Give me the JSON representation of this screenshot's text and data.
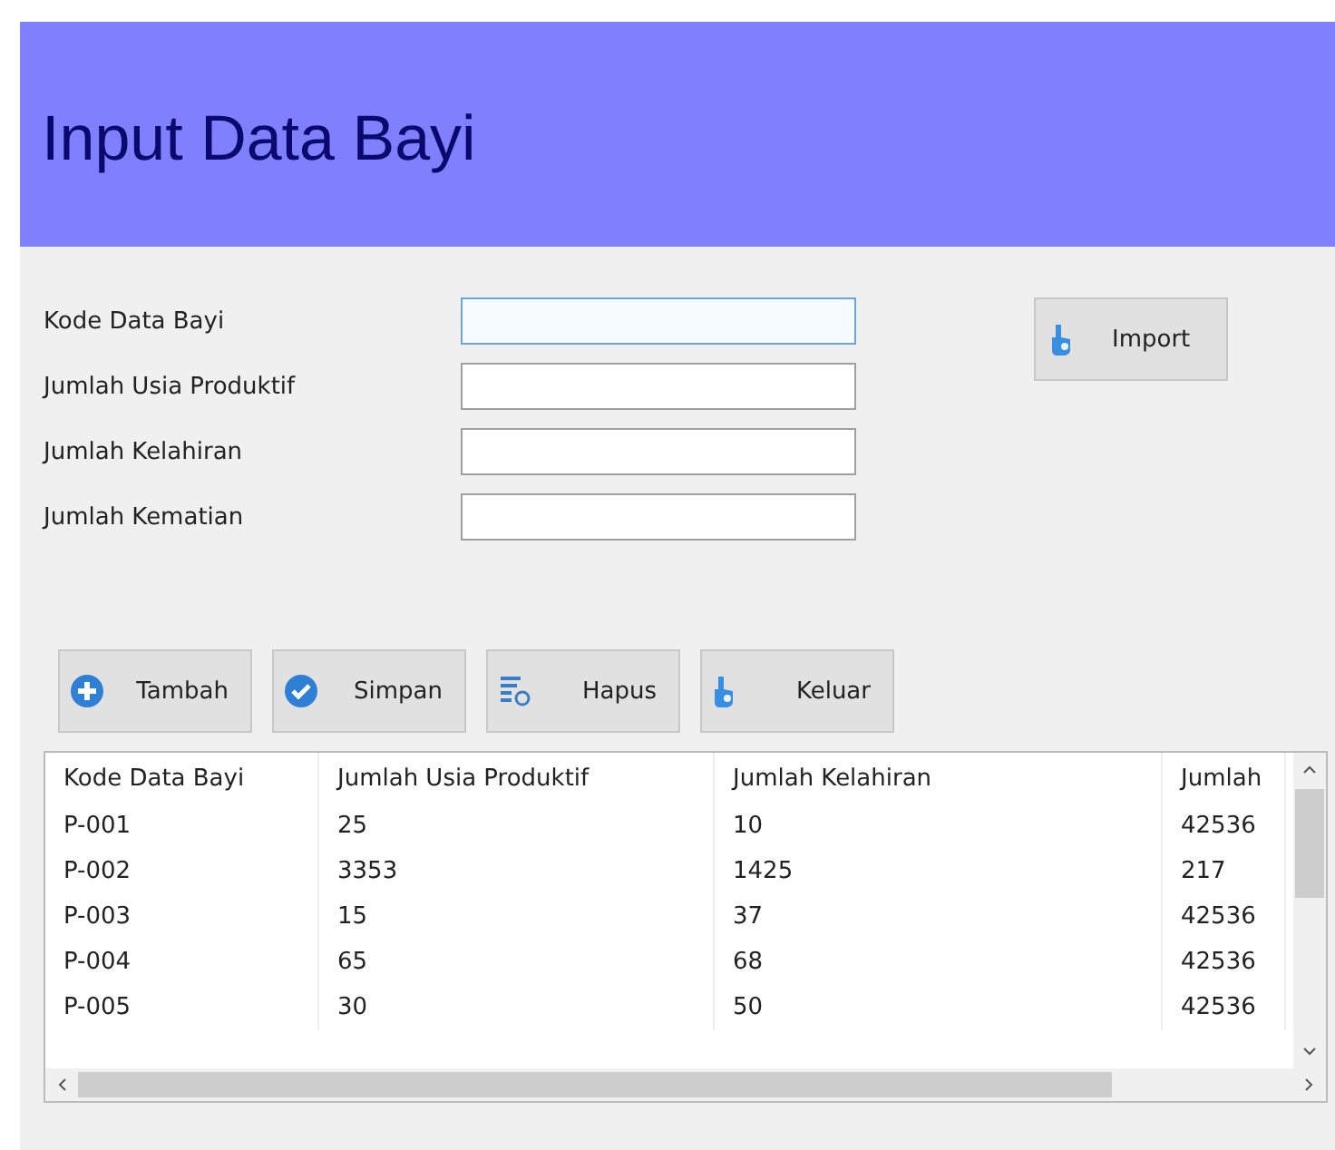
{
  "header": {
    "title": "Input Data Bayi"
  },
  "form": {
    "fields": [
      {
        "label": "Kode Data Bayi",
        "focused": true
      },
      {
        "label": "Jumlah Usia Produktif",
        "focused": false
      },
      {
        "label": "Jumlah Kelahiran",
        "focused": false
      },
      {
        "label": "Jumlah Kematian",
        "focused": false
      }
    ],
    "import_button": {
      "label": "Import"
    }
  },
  "actions": [
    {
      "label": "Tambah",
      "kind": "add"
    },
    {
      "label": "Simpan",
      "kind": "save"
    },
    {
      "label": "Hapus",
      "kind": "delete"
    },
    {
      "label": "Keluar",
      "kind": "exit"
    }
  ],
  "table": {
    "columns": [
      "Kode Data Bayi",
      "Jumlah Usia Produktif",
      "Jumlah Kelahiran",
      "Jumlah"
    ],
    "rows": [
      [
        "P-001",
        "25",
        "10",
        "42536"
      ],
      [
        "P-002",
        "3353",
        "1425",
        "217"
      ],
      [
        "P-003",
        "15",
        "37",
        "42536"
      ],
      [
        "P-004",
        "65",
        "68",
        "42536"
      ],
      [
        "P-005",
        "30",
        "50",
        "42536"
      ]
    ]
  }
}
